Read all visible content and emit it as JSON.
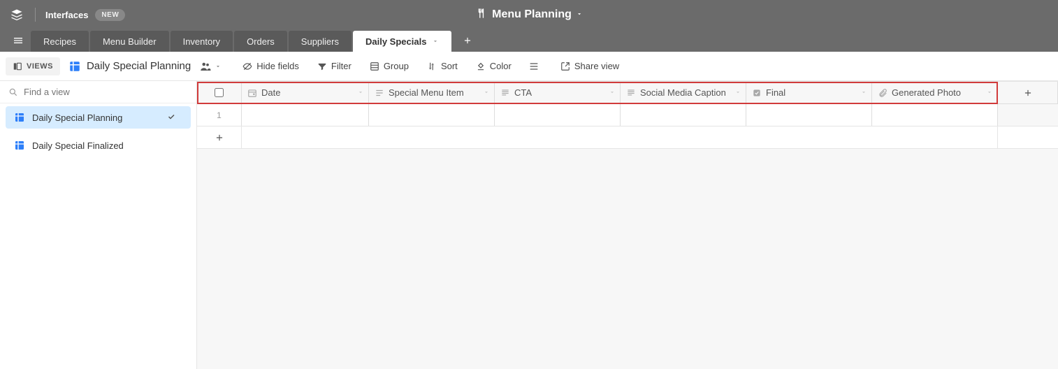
{
  "topbar": {
    "interfaces_label": "Interfaces",
    "new_badge": "NEW",
    "workspace_title": "Menu Planning"
  },
  "tabs": [
    {
      "label": "Recipes",
      "active": false
    },
    {
      "label": "Menu Builder",
      "active": false
    },
    {
      "label": "Inventory",
      "active": false
    },
    {
      "label": "Orders",
      "active": false
    },
    {
      "label": "Suppliers",
      "active": false
    },
    {
      "label": "Daily Specials",
      "active": true
    }
  ],
  "toolbar": {
    "views_label": "VIEWS",
    "view_title": "Daily Special Planning",
    "hide_fields": "Hide fields",
    "filter": "Filter",
    "group": "Group",
    "sort": "Sort",
    "color": "Color",
    "share": "Share view"
  },
  "sidebar": {
    "search_placeholder": "Find a view",
    "views": [
      {
        "label": "Daily Special Planning",
        "active": true
      },
      {
        "label": "Daily Special Finalized",
        "active": false
      }
    ]
  },
  "columns": [
    {
      "label": "Date",
      "type": "date"
    },
    {
      "label": "Special Menu Item",
      "type": "text"
    },
    {
      "label": "CTA",
      "type": "longtext"
    },
    {
      "label": "Social Media Caption",
      "type": "longtext"
    },
    {
      "label": "Final",
      "type": "checkbox"
    },
    {
      "label": "Generated Photo",
      "type": "attachment"
    }
  ],
  "rows": [
    {
      "num": "1"
    }
  ]
}
